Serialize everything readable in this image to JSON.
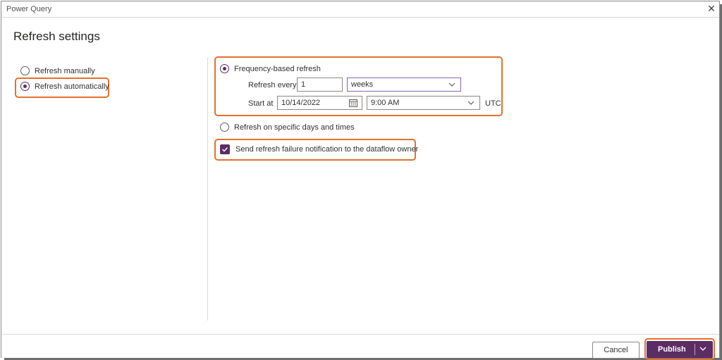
{
  "window": {
    "title": "Power Query",
    "close_glyph": "✕"
  },
  "page": {
    "title": "Refresh settings"
  },
  "refresh_mode": {
    "options": [
      {
        "label": "Refresh manually",
        "checked": false
      },
      {
        "label": "Refresh automatically",
        "checked": true
      }
    ]
  },
  "schedule": {
    "frequency_label": "Frequency-based refresh",
    "refresh_every_label": "Refresh every",
    "refresh_every_value": "1",
    "unit_value": "weeks",
    "start_at_label": "Start at",
    "start_date": "10/14/2022",
    "start_time": "9:00 AM",
    "timezone": "UTC",
    "specific_label": "Refresh on specific days and times"
  },
  "notification": {
    "label": "Send refresh failure notification to the dataflow owner",
    "checked": true
  },
  "footer": {
    "cancel_label": "Cancel",
    "publish_label": "Publish"
  },
  "colors": {
    "accent": "#5c2d64",
    "highlight": "#e4712b"
  },
  "icons": [
    "close-icon",
    "calendar-icon",
    "chevron-down-icon",
    "checkmark-icon"
  ]
}
